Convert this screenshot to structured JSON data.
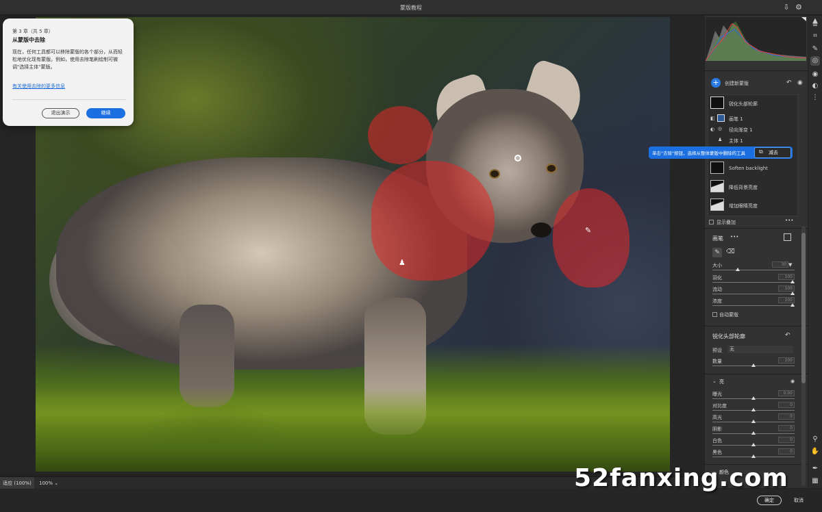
{
  "window": {
    "title": "蒙版教程"
  },
  "dialog": {
    "step": "第 3 章（共 5 章）",
    "heading": "从蒙版中去除",
    "body": "现在，任何工具都可以移除蒙版的各个部分，从而轻松地优化现有蒙版。例如，使用去除笔刷绘制可微调\"选择主体\"蒙版。",
    "link": "有关使用去除的更多信息",
    "exit_label": "退出演示",
    "continue_label": "继续"
  },
  "panel": {
    "create_mask": "创建新蒙版",
    "masks": [
      {
        "name": "锐化头部轮廓"
      },
      {
        "name": "画笔 1"
      },
      {
        "name": "径向渐变 1"
      },
      {
        "name": "主体 1"
      },
      {
        "name": "Soften backlight"
      },
      {
        "name": "降低背景亮度"
      },
      {
        "name": "增加眼睛亮度"
      }
    ],
    "callout_text": "单击\"去除\"按钮，选择从整体蒙版中删除的工具",
    "subtract_label": "减去",
    "show_overlay": "显示叠加",
    "brush_section": {
      "title": "画笔",
      "sliders": [
        {
          "label": "大小",
          "value": "30",
          "fraction": 0.3
        },
        {
          "label": "羽化",
          "value": "100",
          "fraction": 1.0
        },
        {
          "label": "流动",
          "value": "100",
          "fraction": 1.0
        },
        {
          "label": "浓度",
          "value": "100",
          "fraction": 1.0
        }
      ],
      "auto_mask": "自动蒙版"
    },
    "adjust_section": {
      "title": "锐化头部轮廓",
      "preset_label": "预设",
      "preset_value": "无",
      "amount_label": "数量",
      "amount_value": "100",
      "amount_fraction": 0.5
    },
    "light_section": {
      "title": "亮",
      "sliders": [
        {
          "label": "曝光",
          "value": "0.00",
          "fraction": 0.5
        },
        {
          "label": "对比度",
          "value": "0",
          "fraction": 0.5
        },
        {
          "label": "高光",
          "value": "0",
          "fraction": 0.5
        },
        {
          "label": "阴影",
          "value": "0",
          "fraction": 0.5
        },
        {
          "label": "白色",
          "value": "0",
          "fraction": 0.5
        },
        {
          "label": "黑色",
          "value": "0",
          "fraction": 0.5
        }
      ]
    },
    "color_section": {
      "title": "颜色"
    }
  },
  "status": {
    "fit": "适应 (100%)",
    "zoom": "100%"
  },
  "footer": {
    "ok": "确定",
    "cancel": "取消"
  },
  "watermark": "52fanxing.com",
  "colors": {
    "accent": "#1b6fe0",
    "mask_overlay": "#e12828"
  },
  "icons": {
    "top": [
      "export-icon",
      "gear-icon"
    ],
    "tools": [
      "mountain-icon",
      "sliders-icon",
      "crop-icon",
      "healing-brush-icon",
      "mask-icon",
      "redeye-icon",
      "preset-icon",
      "more-icon",
      "zoom-icon",
      "hand-icon",
      "sampler-icon",
      "grid-icon"
    ]
  }
}
